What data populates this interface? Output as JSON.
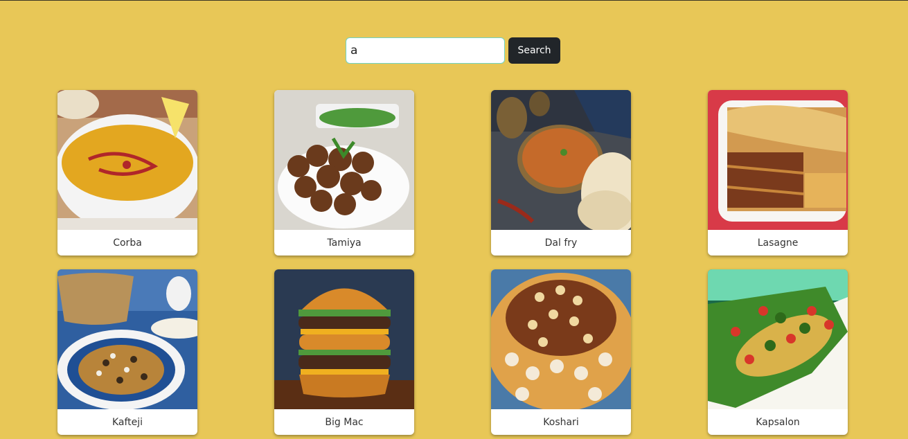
{
  "search": {
    "value": "a",
    "button_label": "Search"
  },
  "meals": [
    {
      "name": "Corba"
    },
    {
      "name": "Tamiya"
    },
    {
      "name": "Dal fry"
    },
    {
      "name": "Lasagne"
    },
    {
      "name": "Kafteji"
    },
    {
      "name": "Big Mac"
    },
    {
      "name": "Koshari"
    },
    {
      "name": "Kapsalon"
    }
  ]
}
